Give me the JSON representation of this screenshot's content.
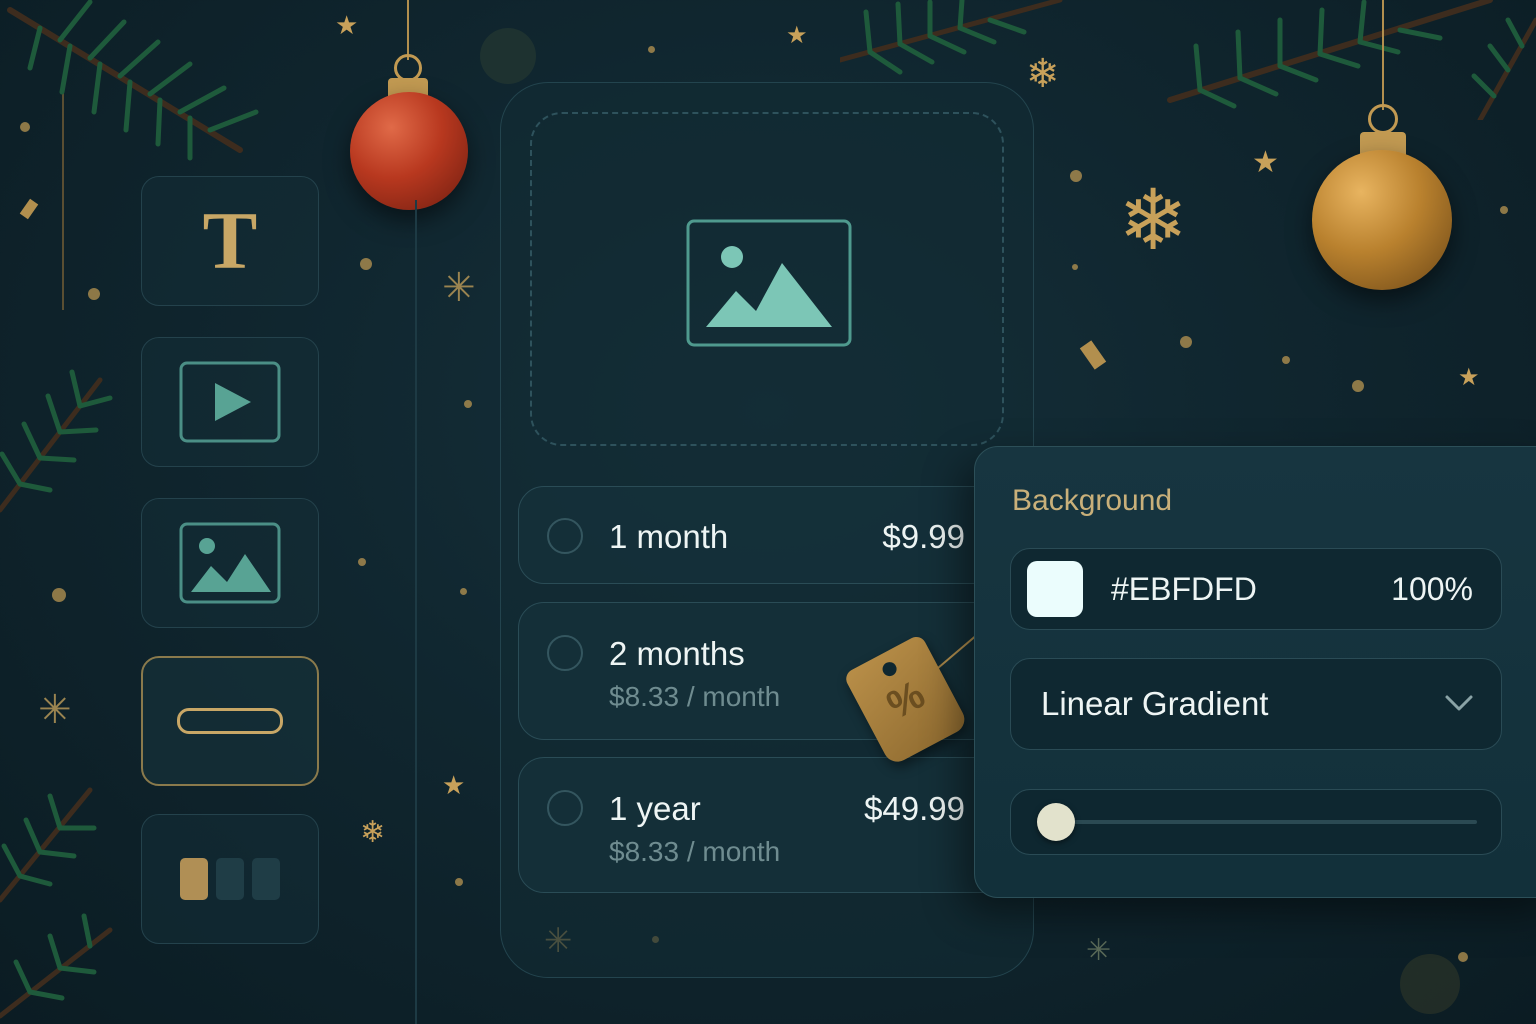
{
  "toolbar": {
    "items": [
      {
        "name": "text-tool",
        "glyph": "T"
      },
      {
        "name": "video-tool"
      },
      {
        "name": "image-tool"
      },
      {
        "name": "button-tool",
        "selected": true
      },
      {
        "name": "carousel-tool"
      }
    ]
  },
  "paywall": {
    "plans": [
      {
        "name": "1 month",
        "price": "$9.99",
        "subtitle": ""
      },
      {
        "name": "2 months",
        "price": "",
        "subtitle": "$8.33 / month",
        "discount_tag": "%"
      },
      {
        "name": "1 year",
        "price": "$49.99",
        "subtitle": "$8.33 / month"
      }
    ]
  },
  "background_panel": {
    "title": "Background",
    "color_hex": "#EBFDFD",
    "opacity": "100%",
    "fill_type": "Linear Gradient",
    "slider_fraction": 0.04
  },
  "colors": {
    "background": "#10262f",
    "accent_gold": "#c8a766",
    "accent_teal": "#7cc6b6",
    "swatch": "#EBFDFD"
  }
}
